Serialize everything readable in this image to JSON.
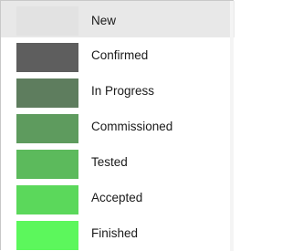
{
  "statuses": [
    {
      "label": "New",
      "color": "#e2e2e2",
      "selected": true
    },
    {
      "label": "Confirmed",
      "color": "#5e5e5e",
      "selected": false
    },
    {
      "label": "In Progress",
      "color": "#5e7d5e",
      "selected": false
    },
    {
      "label": "Commissioned",
      "color": "#5e9b5e",
      "selected": false
    },
    {
      "label": "Tested",
      "color": "#5cba5c",
      "selected": false
    },
    {
      "label": "Accepted",
      "color": "#5bd85b",
      "selected": false
    },
    {
      "label": "Finished",
      "color": "#5cf75c",
      "selected": false
    }
  ]
}
